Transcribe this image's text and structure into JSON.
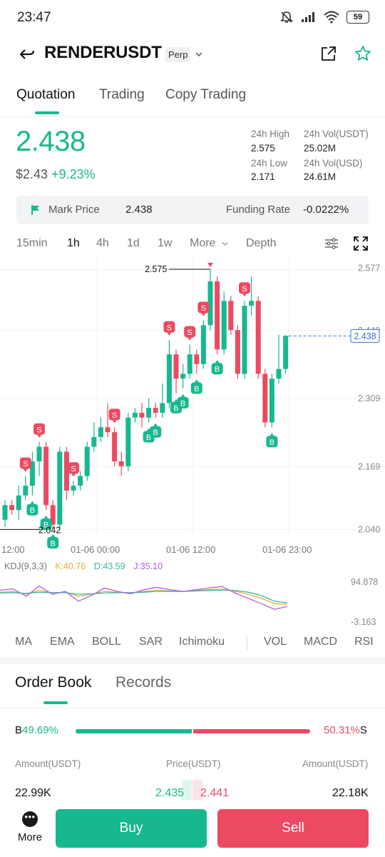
{
  "status_bar": {
    "time": "23:47",
    "battery": "59"
  },
  "header": {
    "symbol": "RENDERUSDT",
    "contract_type": "Perp"
  },
  "tabs": [
    {
      "label": "Quotation",
      "active": true
    },
    {
      "label": "Trading",
      "active": false
    },
    {
      "label": "Copy Trading",
      "active": false
    }
  ],
  "ticker": {
    "last_price": "2.438",
    "usd_price": "$2.43",
    "change_pct": "+9.23%",
    "high_label": "24h High",
    "high": "2.575",
    "low_label": "24h Low",
    "low": "2.171",
    "vol_usdt_label": "24h Vol(USDT)",
    "vol_usdt": "25.02M",
    "vol_usd_label": "24h Vol(USD)",
    "vol_usd": "24.61M"
  },
  "mark_bar": {
    "mark_label": "Mark Price",
    "mark_value": "2.438",
    "funding_label": "Funding Rate",
    "funding_value": "-0.0222%"
  },
  "intervals": [
    {
      "label": "15min",
      "active": false
    },
    {
      "label": "1h",
      "active": true
    },
    {
      "label": "4h",
      "active": false
    },
    {
      "label": "1d",
      "active": false
    },
    {
      "label": "1w",
      "active": false
    },
    {
      "label": "More",
      "active": false
    },
    {
      "label": "Depth",
      "active": false
    }
  ],
  "colors": {
    "up": "#17b88f",
    "down": "#eb4a62",
    "accent": "#17b88f",
    "price_line": "#3b6fd4"
  },
  "chart_data": [
    {
      "type": "candlestick",
      "title": "",
      "interval": "1h",
      "y_axis_labels": [
        "2.577",
        "2.449",
        "2.309",
        "2.169",
        "2.040"
      ],
      "ylim": [
        2.02,
        2.6
      ],
      "x_axis_labels": [
        "12:00",
        "01-06 00:00",
        "01-06 12:00",
        "01-06 23:00"
      ],
      "current_price_label": "2.438",
      "high_marker": "2.575",
      "low_marker": "2.042",
      "candles": [
        [
          2.06,
          2.09,
          2.045,
          2.1
        ],
        [
          2.09,
          2.08,
          2.07,
          2.1
        ],
        [
          2.08,
          2.11,
          2.06,
          2.13
        ],
        [
          2.11,
          2.13,
          2.1,
          2.15
        ],
        [
          2.13,
          2.18,
          2.11,
          2.2
        ],
        [
          2.18,
          2.21,
          2.15,
          2.22
        ],
        [
          2.21,
          2.09,
          2.08,
          2.22
        ],
        [
          2.09,
          2.05,
          2.042,
          2.1
        ],
        [
          2.05,
          2.2,
          2.04,
          2.21
        ],
        [
          2.2,
          2.12,
          2.1,
          2.21
        ],
        [
          2.12,
          2.13,
          2.11,
          2.14
        ],
        [
          2.13,
          2.15,
          2.12,
          2.16
        ],
        [
          2.15,
          2.21,
          2.14,
          2.22
        ],
        [
          2.21,
          2.23,
          2.2,
          2.26
        ],
        [
          2.23,
          2.25,
          2.22,
          2.27
        ],
        [
          2.25,
          2.24,
          2.23,
          2.3
        ],
        [
          2.24,
          2.18,
          2.17,
          2.25
        ],
        [
          2.18,
          2.17,
          2.15,
          2.2
        ],
        [
          2.17,
          2.27,
          2.16,
          2.28
        ],
        [
          2.27,
          2.28,
          2.26,
          2.29
        ],
        [
          2.28,
          2.27,
          2.25,
          2.3
        ],
        [
          2.27,
          2.29,
          2.26,
          2.31
        ],
        [
          2.29,
          2.28,
          2.27,
          2.3
        ],
        [
          2.28,
          2.3,
          2.27,
          2.34
        ],
        [
          2.3,
          2.4,
          2.29,
          2.43
        ],
        [
          2.4,
          2.35,
          2.32,
          2.41
        ],
        [
          2.35,
          2.36,
          2.33,
          2.38
        ],
        [
          2.36,
          2.4,
          2.35,
          2.42
        ],
        [
          2.4,
          2.38,
          2.36,
          2.41
        ],
        [
          2.38,
          2.46,
          2.37,
          2.47
        ],
        [
          2.46,
          2.55,
          2.45,
          2.575
        ],
        [
          2.55,
          2.41,
          2.4,
          2.56
        ],
        [
          2.41,
          2.51,
          2.4,
          2.53
        ],
        [
          2.51,
          2.45,
          2.44,
          2.52
        ],
        [
          2.45,
          2.36,
          2.35,
          2.46
        ],
        [
          2.36,
          2.5,
          2.35,
          2.51
        ],
        [
          2.5,
          2.51,
          2.48,
          2.56
        ],
        [
          2.51,
          2.36,
          2.35,
          2.52
        ],
        [
          2.36,
          2.26,
          2.25,
          2.37
        ],
        [
          2.26,
          2.35,
          2.25,
          2.36
        ],
        [
          2.35,
          2.37,
          2.34,
          2.44
        ],
        [
          2.37,
          2.438,
          2.36,
          2.44
        ]
      ],
      "signals": [
        {
          "candle": 3,
          "type": "S"
        },
        {
          "candle": 4,
          "type": "B"
        },
        {
          "candle": 5,
          "type": "S"
        },
        {
          "candle": 6,
          "type": "B"
        },
        {
          "candle": 7,
          "type": "B"
        },
        {
          "candle": 10,
          "type": "S"
        },
        {
          "candle": 16,
          "type": "S"
        },
        {
          "candle": 21,
          "type": "B"
        },
        {
          "candle": 22,
          "type": "B"
        },
        {
          "candle": 24,
          "type": "S"
        },
        {
          "candle": 25,
          "type": "B"
        },
        {
          "candle": 26,
          "type": "B"
        },
        {
          "candle": 27,
          "type": "S"
        },
        {
          "candle": 28,
          "type": "B"
        },
        {
          "candle": 29,
          "type": "S"
        },
        {
          "candle": 31,
          "type": "B"
        },
        {
          "candle": 35,
          "type": "S"
        },
        {
          "candle": 39,
          "type": "B"
        }
      ]
    },
    {
      "type": "line",
      "title": "KDJ(9,3,3)",
      "y_axis_labels": [
        "94.878",
        "-3.163"
      ],
      "ylim": [
        -3.163,
        94.878
      ],
      "series": [
        {
          "name": "K:40.76",
          "color": "#e4b13e",
          "values": [
            70,
            72,
            65,
            75,
            68,
            70,
            60,
            65,
            72,
            70,
            68,
            72,
            75,
            73,
            72,
            74,
            76,
            78,
            72,
            65,
            55,
            42,
            41
          ]
        },
        {
          "name": "D:43.59",
          "color": "#3bb6a5",
          "values": [
            68,
            69,
            67,
            70,
            69,
            69,
            65,
            66,
            68,
            69,
            69,
            70,
            72,
            72,
            72,
            73,
            74,
            75,
            74,
            70,
            62,
            48,
            44
          ]
        },
        {
          "name": "J:35.10",
          "color": "#b45ddd",
          "values": [
            75,
            78,
            60,
            85,
            65,
            72,
            48,
            62,
            80,
            72,
            66,
            76,
            82,
            76,
            72,
            76,
            80,
            84,
            68,
            55,
            42,
            28,
            35
          ]
        }
      ]
    }
  ],
  "indicators": [
    "MA",
    "EMA",
    "BOLL",
    "SAR",
    "Ichimoku",
    "VOL",
    "MACD",
    "RSI"
  ],
  "order_book": {
    "tabs": [
      {
        "label": "Order Book",
        "active": true
      },
      {
        "label": "Records",
        "active": false
      }
    ],
    "buy_prefix": "B",
    "buy_pct": "49.69%",
    "buy_ratio": 0.4969,
    "sell_prefix": "S",
    "sell_pct": "50.31%",
    "col_amount_left": "Amount(USDT)",
    "col_price": "Price(USDT)",
    "col_amount_right": "Amount(USDT)",
    "row": {
      "bid_amount": "22.99K",
      "bid_price": "2.435",
      "ask_price": "2.441",
      "ask_amount": "22.18K"
    }
  },
  "bottom": {
    "more_label": "More",
    "buy_label": "Buy",
    "sell_label": "Sell"
  }
}
